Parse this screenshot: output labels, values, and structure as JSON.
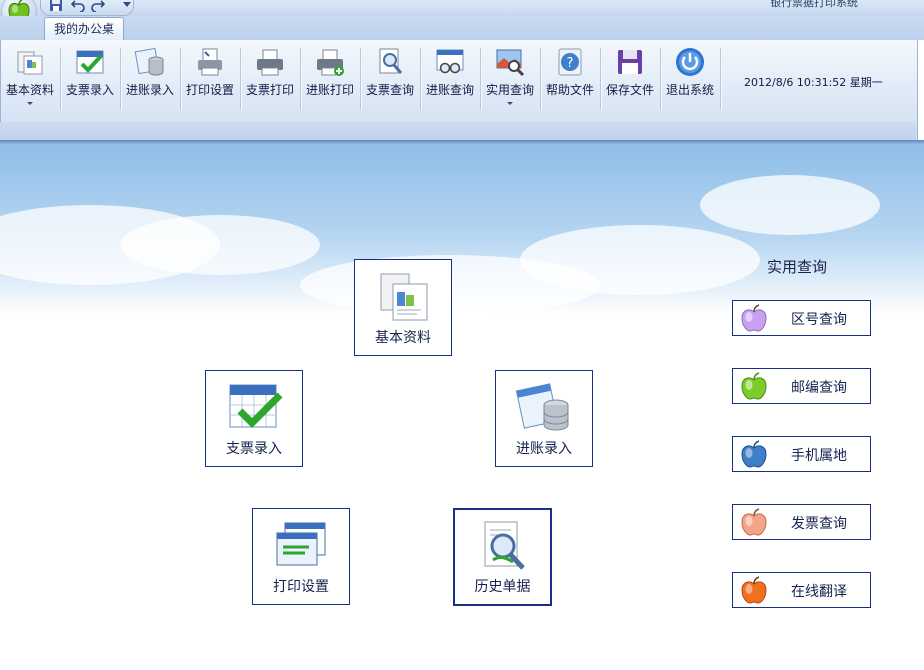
{
  "window": {
    "title": "银行票据打印系统"
  },
  "tabs": [
    {
      "label": "我的办公桌"
    }
  ],
  "toolbar": {
    "buttons": [
      {
        "label": "基本资料",
        "dropdown": true
      },
      {
        "label": "支票录入"
      },
      {
        "label": "进账录入"
      },
      {
        "label": "打印设置"
      },
      {
        "label": "支票打印"
      },
      {
        "label": "进账打印"
      },
      {
        "label": "支票查询"
      },
      {
        "label": "进账查询"
      },
      {
        "label": "实用查询",
        "dropdown": true
      },
      {
        "label": "帮助文件"
      },
      {
        "label": "保存文件"
      },
      {
        "label": "退出系统"
      }
    ],
    "datetime": "2012/8/6 10:31:52 星期一"
  },
  "desk": {
    "tiles": [
      {
        "label": "基本资料"
      },
      {
        "label": "支票录入"
      },
      {
        "label": "进账录入"
      },
      {
        "label": "打印设置"
      },
      {
        "label": "历史单据"
      }
    ]
  },
  "utilities": {
    "title": "实用查询",
    "items": [
      {
        "label": "区号查询",
        "color": "#c8a2f0"
      },
      {
        "label": "邮编查询",
        "color": "#7ccc2a"
      },
      {
        "label": "手机属地",
        "color": "#3e7fc8"
      },
      {
        "label": "发票查询",
        "color": "#f3a58a"
      },
      {
        "label": "在线翻译",
        "color": "#f0701e"
      }
    ]
  },
  "colors": {
    "accent": "#1a2f8a",
    "ribbon": "#dde8f6",
    "sky": "#8fbfe8"
  }
}
